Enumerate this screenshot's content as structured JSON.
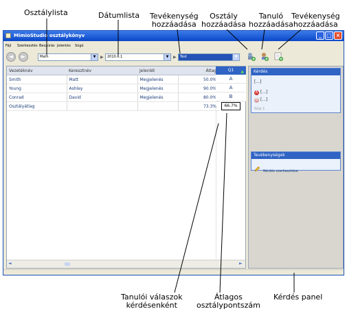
{
  "callouts": {
    "class_list": "Osztálylista",
    "date_list": "Dátumlista",
    "add_activity_1": "Tevékenység\nhozzáadása",
    "add_class": "Osztály\nhozzáadása",
    "add_student": "Tanuló\nhozzáadása",
    "add_activity_2": "Tevékenység\nhozzáadása",
    "student_answers": "Tanulói válaszok\nkérdésenként",
    "avg_class_score": "Átlagos\nosztálypontszám",
    "question_panel": "Kérdés panel"
  },
  "window": {
    "title": "MimioStudio osztálykönyv",
    "buttons": {
      "minimize": "_",
      "maximize": "□",
      "close": "×"
    }
  },
  "menu": [
    "Fájl",
    "Szerkesztés",
    "Beszúrás",
    "Jelentés",
    "Súgó"
  ],
  "toolbar": {
    "class_combo_value": "Math",
    "date_combo_value": "2010.6.1",
    "activity_combo_value": "Test",
    "back_glyph": "◄",
    "forward_glyph": "►",
    "sep_glyph": "▶",
    "dropdown_glyph": "▼"
  },
  "grid": {
    "headers": [
      "Vezetéknév",
      "Keresztnév",
      "Jelenlét",
      "Átlag"
    ],
    "rows": [
      {
        "last": "Smith",
        "first": "Matt",
        "presence": "Megjelenés",
        "avg": "50.0%"
      },
      {
        "last": "Young",
        "first": "Ashley",
        "presence": "Megjelenés",
        "avg": "90.0%"
      },
      {
        "last": "Conrad",
        "first": "David",
        "presence": "Megjelenés",
        "avg": "80.0%"
      }
    ],
    "class_avg_label": "Osztályátlag",
    "class_avg_value": "73.3%"
  },
  "question_column": {
    "header": "Q1",
    "answers": [
      "A",
      "A",
      "B"
    ],
    "average": "66.7%"
  },
  "question_panel": {
    "title": "Kérdés",
    "question_text": "[...]",
    "answer_a": "[...]",
    "answer_b": "[...]",
    "answer_a_badge": "A",
    "answer_b_badge": "B",
    "score_label": "Súly 1"
  },
  "activities_panel": {
    "title": "Tevékenységek",
    "item": "Kérdés szerkesztése"
  },
  "colors": {
    "title_bar": "#0b47c8",
    "selected_header": "#2f63c4",
    "correct_badge": "#d23a3a",
    "wrong_badge": "#d9a0a0"
  }
}
